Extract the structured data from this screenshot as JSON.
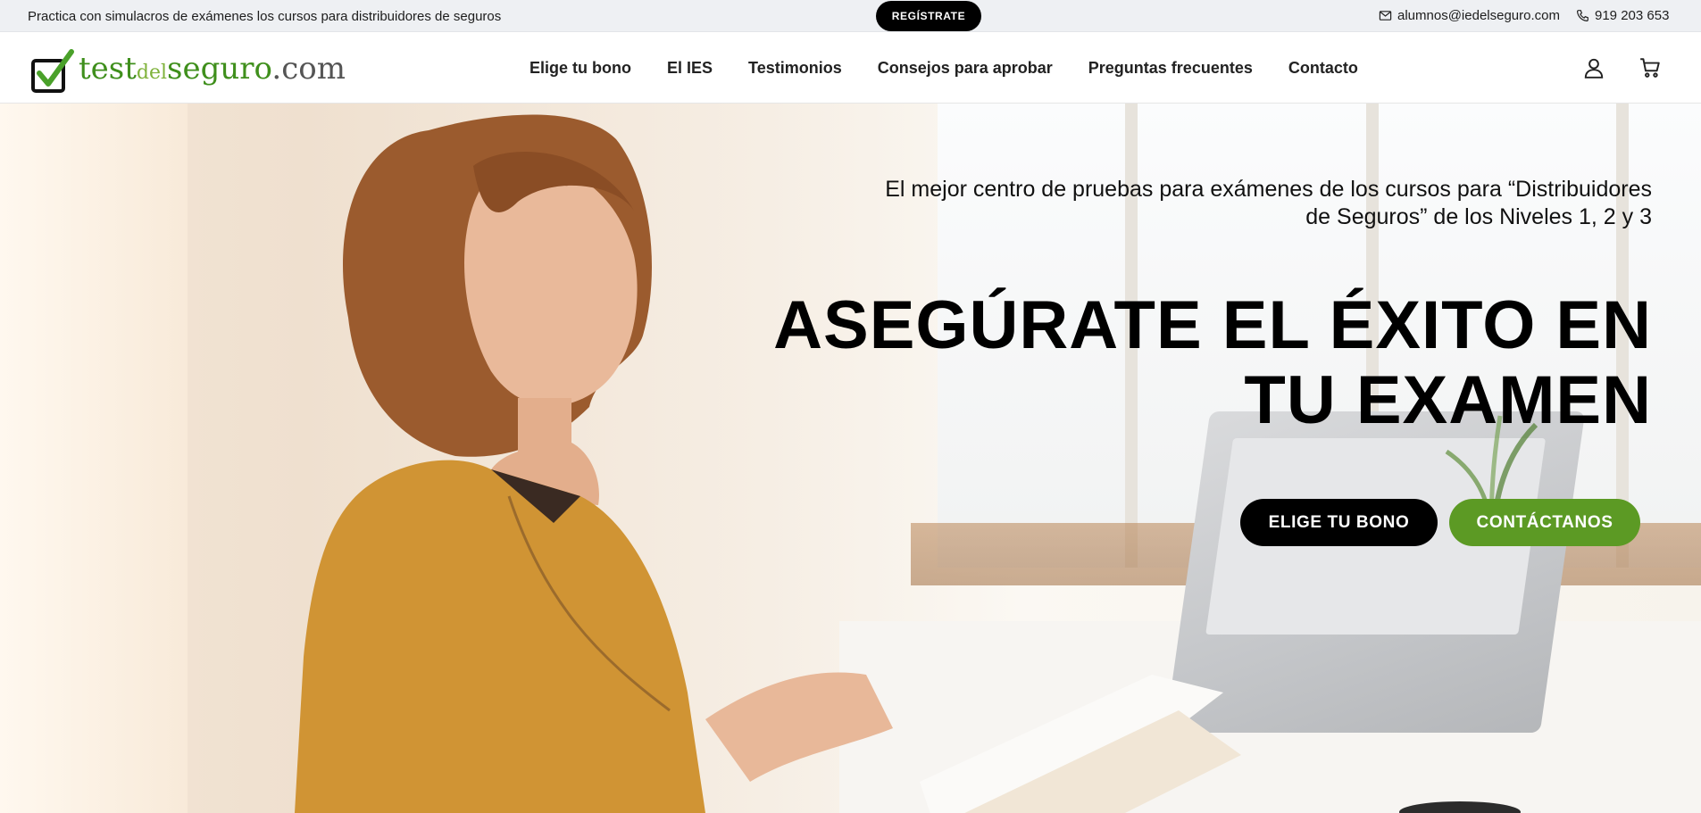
{
  "topbar": {
    "promo_text": "Practica con simulacros de exámenes los cursos para distribuidores de seguros",
    "register_label": "REGÍSTRATE",
    "email": "alumnos@iedelseguro.com",
    "phone": "919 203 653",
    "email_icon": "envelope-icon",
    "phone_icon": "phone-icon"
  },
  "header": {
    "logo": {
      "part1": "test",
      "part2": "del",
      "part3": "seguro",
      "part4": ".com"
    },
    "nav": [
      "Elige tu bono",
      "El IES",
      "Testimonios",
      "Consejos para aprobar",
      "Preguntas frecuentes",
      "Contacto"
    ],
    "icons": {
      "account": "user-icon",
      "cart": "cart-icon"
    }
  },
  "hero": {
    "subtitle_line1": "El mejor centro de pruebas para exámenes de los cursos para “Distribuidores",
    "subtitle_line2": "de Seguros” de los Niveles 1, 2 y 3",
    "headline_line1": "ASEGÚRATE EL ÉXITO EN",
    "headline_line2": "TU EXAMEN",
    "primary_button": "ELIGE TU BONO",
    "secondary_button": "CONTÁCTANOS"
  },
  "colors": {
    "brand_green": "#5c9a24",
    "black": "#000000",
    "topbar_bg": "#eef0f3"
  }
}
